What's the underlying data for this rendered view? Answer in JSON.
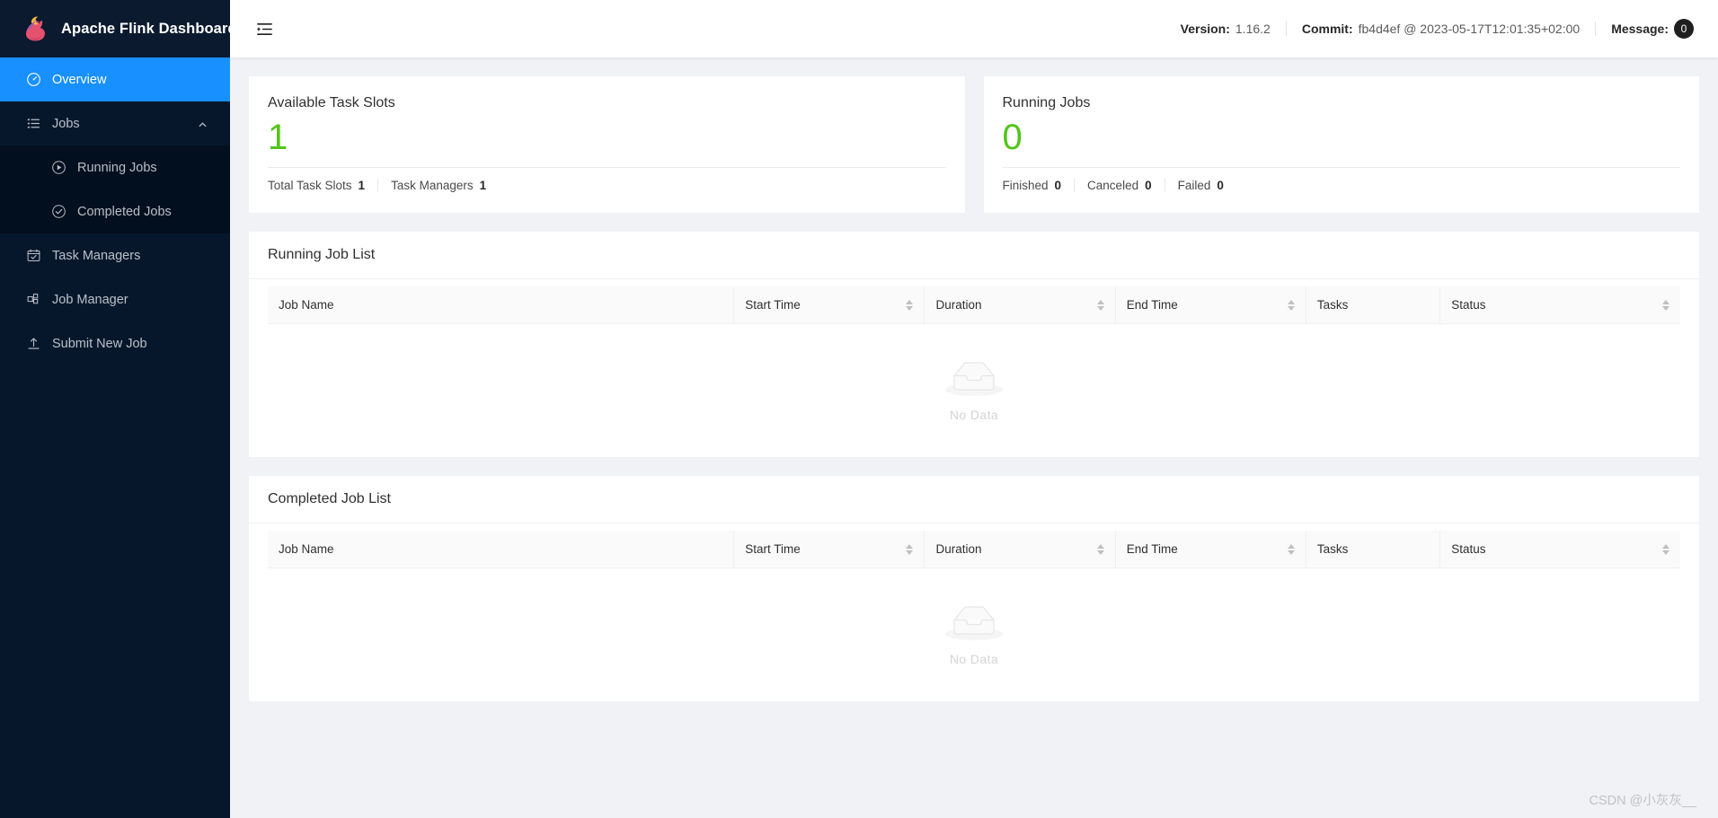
{
  "app": {
    "brand_title": "Apache Flink Dashboard",
    "logo_icon": "flink-squirrel-logo"
  },
  "topbar": {
    "fold_icon": "menu-fold-icon",
    "version_label": "Version:",
    "version_value": "1.16.2",
    "commit_label": "Commit:",
    "commit_value": "fb4d4ef @ 2023-05-17T12:01:35+02:00",
    "message_label": "Message:",
    "message_count": "0"
  },
  "sidebar": {
    "items": [
      {
        "label": "Overview",
        "icon": "dashboard-icon",
        "active": true
      },
      {
        "label": "Jobs",
        "icon": "unordered-list-icon",
        "active": false,
        "expanded": true
      },
      {
        "label": "Running Jobs",
        "icon": "play-circle-icon",
        "active": false,
        "sub": true
      },
      {
        "label": "Completed Jobs",
        "icon": "check-circle-icon",
        "active": false,
        "sub": true
      },
      {
        "label": "Task Managers",
        "icon": "schedule-icon",
        "active": false
      },
      {
        "label": "Job Manager",
        "icon": "blocks-icon",
        "active": false
      },
      {
        "label": "Submit New Job",
        "icon": "upload-icon",
        "active": false
      }
    ]
  },
  "cards": {
    "task_slots": {
      "title": "Available Task Slots",
      "value": "1",
      "value_color": "#52c41a",
      "footer": [
        {
          "label": "Total Task Slots",
          "value": "1"
        },
        {
          "label": "Task Managers",
          "value": "1"
        }
      ]
    },
    "running_jobs": {
      "title": "Running Jobs",
      "value": "0",
      "value_color": "#52c41a",
      "footer": [
        {
          "label": "Finished",
          "value": "0"
        },
        {
          "label": "Canceled",
          "value": "0"
        },
        {
          "label": "Failed",
          "value": "0"
        }
      ]
    }
  },
  "running_job_list": {
    "title": "Running Job List",
    "columns": [
      {
        "label": "Job Name",
        "sortable": false
      },
      {
        "label": "Start Time",
        "sortable": true
      },
      {
        "label": "Duration",
        "sortable": true
      },
      {
        "label": "End Time",
        "sortable": true
      },
      {
        "label": "Tasks",
        "sortable": false
      },
      {
        "label": "Status",
        "sortable": true
      }
    ],
    "rows": [],
    "empty_text": "No Data",
    "empty_icon": "empty-inbox-icon"
  },
  "completed_job_list": {
    "title": "Completed Job List",
    "columns": [
      {
        "label": "Job Name",
        "sortable": false
      },
      {
        "label": "Start Time",
        "sortable": true
      },
      {
        "label": "Duration",
        "sortable": true
      },
      {
        "label": "End Time",
        "sortable": true
      },
      {
        "label": "Tasks",
        "sortable": false
      },
      {
        "label": "Status",
        "sortable": true
      }
    ],
    "rows": [],
    "empty_text": "No Data",
    "empty_icon": "empty-inbox-icon"
  },
  "watermark": "CSDN @小灰灰__",
  "colors": {
    "sidebar_bg": "#06172c",
    "submenu_bg": "#020f1f",
    "accent": "#1890ff",
    "content_bg": "#f0f2f5",
    "stat_green": "#52c41a"
  }
}
